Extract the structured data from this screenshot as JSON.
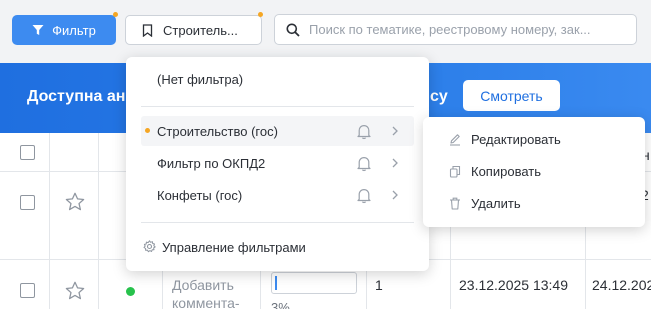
{
  "toolbar": {
    "filter_button_label": "Фильтр",
    "current_filter_label": "Строитель...",
    "search_placeholder": "Поиск по тематике, реестровому номеру, зак..."
  },
  "banner": {
    "title": "Доступна ан",
    "title_tail": "су",
    "watch_button_label": "Смотреть"
  },
  "dropdown": {
    "no_filter_label": "(Нет фильтра)",
    "filters": [
      {
        "label": "Строительство (гос)",
        "active": true
      },
      {
        "label": "Фильтр по ОКПД2",
        "active": false
      },
      {
        "label": "Конфеты (гос)",
        "active": false
      }
    ],
    "manage_label": "Управление фильтрами"
  },
  "submenu": {
    "items": [
      {
        "label": "Редактировать",
        "icon": "pencil-icon"
      },
      {
        "label": "Копировать",
        "icon": "copy-icon"
      },
      {
        "label": "Удалить",
        "icon": "trash-icon"
      }
    ]
  },
  "table": {
    "row2": {
      "comment": "Добавить коммента-",
      "progress": "3%",
      "progress_value": 0.03,
      "number": "1",
      "date1": "23.12.2025 13:49",
      "date2": "24.12.202"
    },
    "row1_partial_num": "2",
    "header_partial": "н"
  },
  "colors": {
    "accent": "#3d8bf0",
    "badge": "#f5a623",
    "status_green": "#27c24c",
    "banner": "#1f6fe0"
  }
}
